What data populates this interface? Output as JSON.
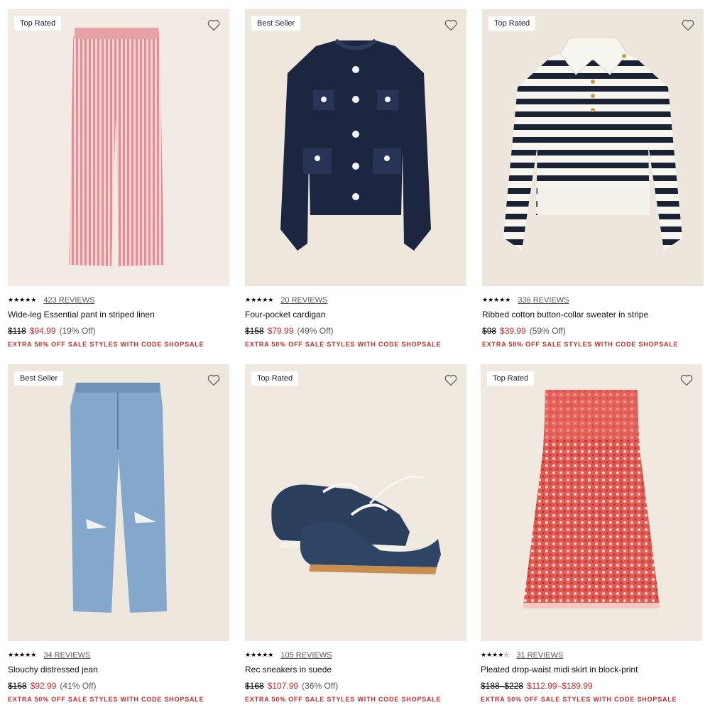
{
  "products": [
    {
      "badge": "Top Rated",
      "stars": "★★★★★",
      "reviews": "423 REVIEWS",
      "title": "Wide-leg Essential pant in striped linen",
      "original_price": "$118",
      "sale_price": "$94.99",
      "discount": "(19% Off)",
      "promo": "EXTRA 50% OFF SALE STYLES WITH CODE SHOPSALE",
      "bg_color": "#f1ebe3",
      "item_color": "#e9a4a8"
    },
    {
      "badge": "Best Seller",
      "stars": "★★★★★",
      "reviews": "20 REVIEWS",
      "title": "Four-pocket cardigan",
      "original_price": "$158",
      "sale_price": "$79.99",
      "discount": "(49% Off)",
      "promo": "EXTRA 50% OFF SALE STYLES WITH CODE SHOPSALE",
      "bg_color": "#eee7dc",
      "item_color": "#1d2640"
    },
    {
      "badge": "Top Rated",
      "stars": "★★★★★",
      "reviews": "336 REVIEWS",
      "title": "Ribbed cotton button-collar sweater in stripe",
      "original_price": "$98",
      "sale_price": "$39.99",
      "discount": "(59% Off)",
      "promo": "EXTRA 50% OFF SALE STYLES WITH CODE SHOPSALE",
      "bg_color": "#ece6dd",
      "item_color": "#1b2233"
    },
    {
      "badge": "Best Seller",
      "stars": "★★★★★",
      "reviews": "34 REVIEWS",
      "title": "Slouchy distressed jean",
      "original_price": "$158",
      "sale_price": "$92.99",
      "discount": "(41% Off)",
      "promo": "EXTRA 50% OFF SALE STYLES WITH CODE SHOPSALE",
      "bg_color": "#eee7dd",
      "item_color": "#7fa3c8"
    },
    {
      "badge": "Top Rated",
      "stars": "★★★★★",
      "reviews": "105 REVIEWS",
      "title": "Rec sneakers in suede",
      "original_price": "$168",
      "sale_price": "$107.99",
      "discount": "(36% Off)",
      "promo": "EXTRA 50% OFF SALE STYLES WITH CODE SHOPSALE",
      "bg_color": "#efe9df",
      "item_color": "#2b3e5c"
    },
    {
      "badge": "Top Rated",
      "stars": "★★★★☆",
      "reviews": "31 REVIEWS",
      "title": "Pleated drop-waist midi skirt in block-print",
      "original_price": "$188–$228",
      "sale_price": "$112.99–$189.99",
      "discount": "",
      "promo": "EXTRA 50% OFF SALE STYLES WITH CODE SHOPSALE",
      "bg_color": "#efe9df",
      "item_color": "#e4574f"
    }
  ],
  "icons": {
    "wishlist": "heart-outline-icon"
  }
}
